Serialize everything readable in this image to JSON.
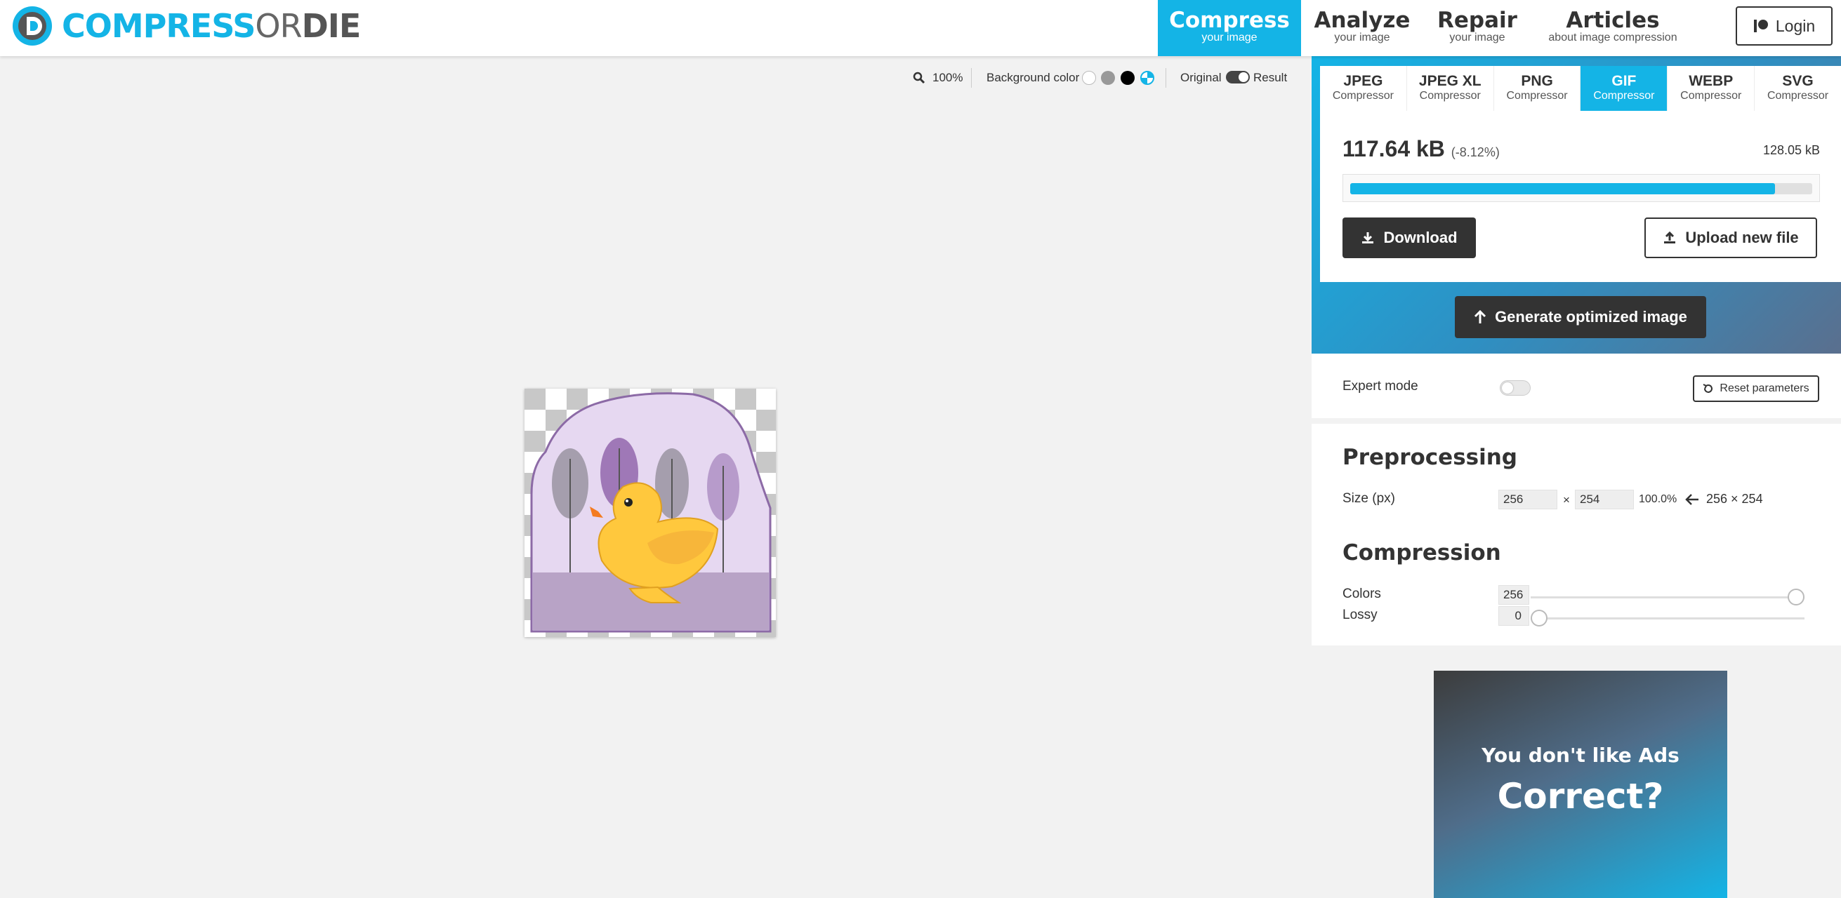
{
  "brand": {
    "logo_part1": "COMPRESS",
    "logo_part2": "OR",
    "logo_part3": "DIE",
    "accent_color": "#14b4e6"
  },
  "nav": [
    {
      "label": "Compress",
      "sub": "your image",
      "active": true
    },
    {
      "label": "Analyze",
      "sub": "your image",
      "active": false
    },
    {
      "label": "Repair",
      "sub": "your image",
      "active": false
    },
    {
      "label": "Articles",
      "sub": "about image compression",
      "active": false
    }
  ],
  "login": {
    "label": "Login",
    "icon": "patreon-icon"
  },
  "toolbar": {
    "zoom": "100%",
    "background_label": "Background color",
    "background_options": [
      "white",
      "gray",
      "black",
      "transparent"
    ],
    "original_label": "Original",
    "result_label": "Result"
  },
  "tabs": [
    {
      "label": "JPEG",
      "sub": "Compressor",
      "active": false
    },
    {
      "label": "JPEG XL",
      "sub": "Compressor",
      "active": false
    },
    {
      "label": "PNG",
      "sub": "Compressor",
      "active": false
    },
    {
      "label": "GIF",
      "sub": "Compressor",
      "active": true
    },
    {
      "label": "WEBP",
      "sub": "Compressor",
      "active": false
    },
    {
      "label": "SVG",
      "sub": "Compressor",
      "active": false
    }
  ],
  "result": {
    "size": "117.64 kB",
    "change": "(-8.12%)",
    "original_size": "128.05 kB",
    "ratio": 0.9188
  },
  "buttons": {
    "download": "Download",
    "upload": "Upload new file",
    "generate": "Generate optimized image",
    "reset": "Reset parameters"
  },
  "expert_mode": {
    "label": "Expert mode",
    "enabled": false
  },
  "preprocessing": {
    "title": "Preprocessing",
    "size_label": "Size (px)",
    "width": "256",
    "height": "254",
    "times": "×",
    "percent": "100.0%",
    "original_dims": "256 × 254"
  },
  "compression": {
    "title": "Compression",
    "colors_label": "Colors",
    "colors_value": "256",
    "colors_level": 1.0,
    "lossy_label": "Lossy",
    "lossy_value": "0",
    "lossy_level": 0.0
  },
  "ad": {
    "line1": "You don't like Ads",
    "line2": "Correct?"
  }
}
